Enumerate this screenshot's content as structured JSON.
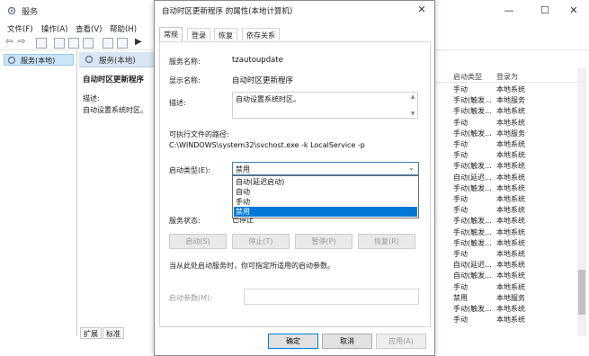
{
  "background": {
    "window_title": "服务",
    "menu": [
      "文件(F)",
      "操作(A)",
      "查看(V)",
      "帮助(H)"
    ],
    "tree_item": "服务(本地)",
    "center_header": "服务(本地)",
    "selected_name": "自动时区更新程序",
    "desc_label": "描述:",
    "desc_text": "自动设置系统时区。",
    "list_headers": [
      "启动类型",
      "登录为"
    ],
    "list_rows": [
      [
        "手动",
        "本地系统"
      ],
      [
        "手动(触发...",
        "本地服务"
      ],
      [
        "手动(触发...",
        "本地系统"
      ],
      [
        "手动",
        "本地系统"
      ],
      [
        "手动(触发...",
        "本地服务"
      ],
      [
        "手动",
        "本地系统"
      ],
      [
        "手动",
        "本地系统"
      ],
      [
        "手动(触发...",
        "本地系统"
      ],
      [
        "自动(延迟...",
        "本地系统"
      ],
      [
        "手动(触发...",
        "本地系统"
      ],
      [
        "手动",
        "本地系统"
      ],
      [
        "手动",
        "本地系统"
      ],
      [
        "手动(触发...",
        "本地系统"
      ],
      [
        "手动(触发...",
        "本地系统"
      ],
      [
        "手动(触发...",
        "本地系统"
      ],
      [
        "手动",
        "本地系统"
      ],
      [
        "自动(延迟...",
        "本地系统"
      ],
      [
        "自动(触发...",
        "本地系统"
      ],
      [
        "手动",
        "本地系统"
      ],
      [
        "禁用",
        "本地服务"
      ],
      [
        "手动(触发...",
        "本地系统"
      ],
      [
        "手动",
        "本地系统"
      ]
    ],
    "tabs": [
      "扩展",
      "标准"
    ]
  },
  "dialog": {
    "title": "自动时区更新程序 的属性(本地计算机)",
    "close": "✕",
    "tabs": [
      "常规",
      "登录",
      "恢复",
      "依存关系"
    ],
    "service_name_label": "服务名称:",
    "service_name": "tzautoupdate",
    "display_name_label": "显示名称:",
    "display_name": "自动时区更新程序",
    "description_label": "描述:",
    "description": "自动设置系统时区。",
    "exe_path_label": "可执行文件的路径:",
    "exe_path": "C:\\WINDOWS\\system32\\svchost.exe -k LocalService -p",
    "startup_type_label": "启动类型(E):",
    "startup_type_value": "禁用",
    "startup_options": [
      "自动(延迟启动)",
      "自动",
      "手动",
      "禁用"
    ],
    "startup_selected_index": 3,
    "status_label": "服务状态:",
    "status_value": "已停止",
    "buttons": {
      "start": "启动(S)",
      "stop": "停止(T)",
      "pause": "暂停(P)",
      "resume": "恢复(R)"
    },
    "hint": "当从此处启动服务时，你可指定所适用的启动参数。",
    "param_label": "启动参数(M):",
    "param_value": "",
    "ok": "确定",
    "cancel": "取消",
    "apply": "应用(A)"
  }
}
